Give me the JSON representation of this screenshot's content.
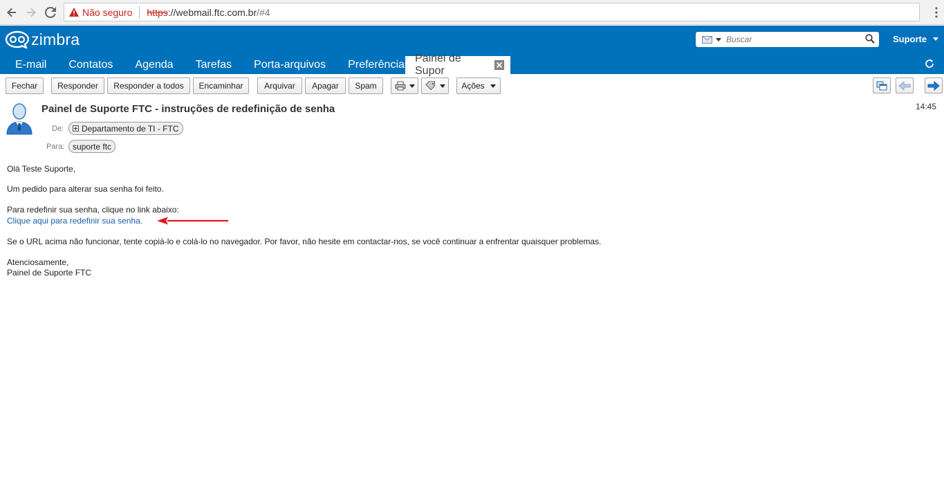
{
  "browser": {
    "security_label": "Não seguro",
    "url_scheme": "https",
    "url_sep": "://",
    "url_host": "webmail.ftc.com.br",
    "url_hash": "/#4"
  },
  "app": {
    "logo_text": "zimbra",
    "search_placeholder": "Buscar",
    "user_label": "Suporte",
    "accent_color": "#0071bb"
  },
  "tabs": [
    {
      "label": "E-mail"
    },
    {
      "label": "Contatos"
    },
    {
      "label": "Agenda"
    },
    {
      "label": "Tarefas"
    },
    {
      "label": "Porta-arquivos"
    },
    {
      "label": "Preferências"
    },
    {
      "label": "Painel de Supor"
    }
  ],
  "toolbar": {
    "close": "Fechar",
    "reply": "Responder",
    "reply_all": "Responder a todos",
    "forward": "Encaminhar",
    "archive": "Arquivar",
    "delete": "Apagar",
    "spam": "Spam",
    "actions": "Ações"
  },
  "message": {
    "subject": "Painel de Suporte FTC - instruções de redefinição de senha",
    "time": "14:45",
    "from_label": "De:",
    "from": "Departamento de TI - FTC",
    "to_label": "Para:",
    "to": "suporte ftc",
    "body": {
      "greeting": "Olá Teste Suporte,",
      "line1": "Um pedido para alterar sua senha foi feito.",
      "line2": "Para redefinir sua senha, clique no link abaixo:",
      "link": "Clique aqui para redefinir sua senha.",
      "line3": "Se o URL acima não funcionar, tente copiá-lo e colá-lo no navegador. Por favor, não hesite em contactar-nos, se você continuar a enfrentar quaisquer problemas.",
      "closing": "Atenciosamente,",
      "signature": "Painel de Suporte FTC"
    }
  }
}
